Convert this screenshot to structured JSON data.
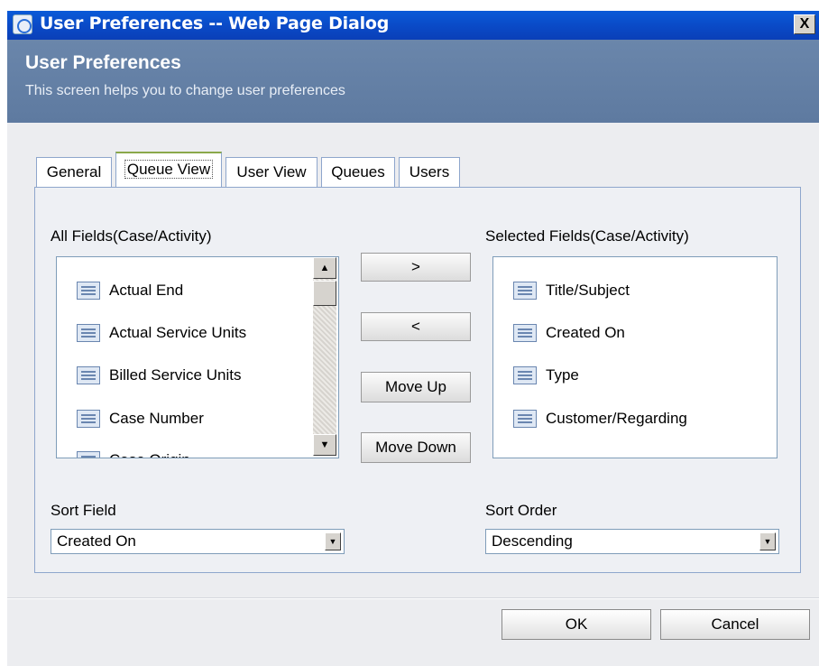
{
  "window": {
    "title": "User Preferences -- Web Page Dialog",
    "close_glyph": "X"
  },
  "header": {
    "title": "User Preferences",
    "subtitle": "This screen helps you to change user preferences"
  },
  "tabs": [
    {
      "label": "General",
      "active": false
    },
    {
      "label": "Queue View",
      "active": true
    },
    {
      "label": "User View",
      "active": false
    },
    {
      "label": "Queues",
      "active": false
    },
    {
      "label": "Users",
      "active": false
    }
  ],
  "queue_view": {
    "all_fields_label": "All Fields(Case/Activity)",
    "selected_fields_label": "Selected Fields(Case/Activity)",
    "all_fields": [
      "Actual End",
      "Actual Service Units",
      "Billed Service Units",
      "Case Number",
      "Case Origin"
    ],
    "selected_fields": [
      "Title/Subject",
      "Created On",
      "Type",
      "Customer/Regarding"
    ],
    "buttons": {
      "add": ">",
      "remove": "<",
      "move_up": "Move Up",
      "move_down": "Move Down"
    },
    "sort_field_label": "Sort Field",
    "sort_field_value": "Created On",
    "sort_order_label": "Sort Order",
    "sort_order_value": "Descending"
  },
  "footer": {
    "ok_label": "OK",
    "cancel_label": "Cancel"
  },
  "icons": {
    "list_item_icon": "document-list-icon",
    "scroll_up": "▲",
    "scroll_down": "▼",
    "dropdown_arrow": "▼"
  }
}
